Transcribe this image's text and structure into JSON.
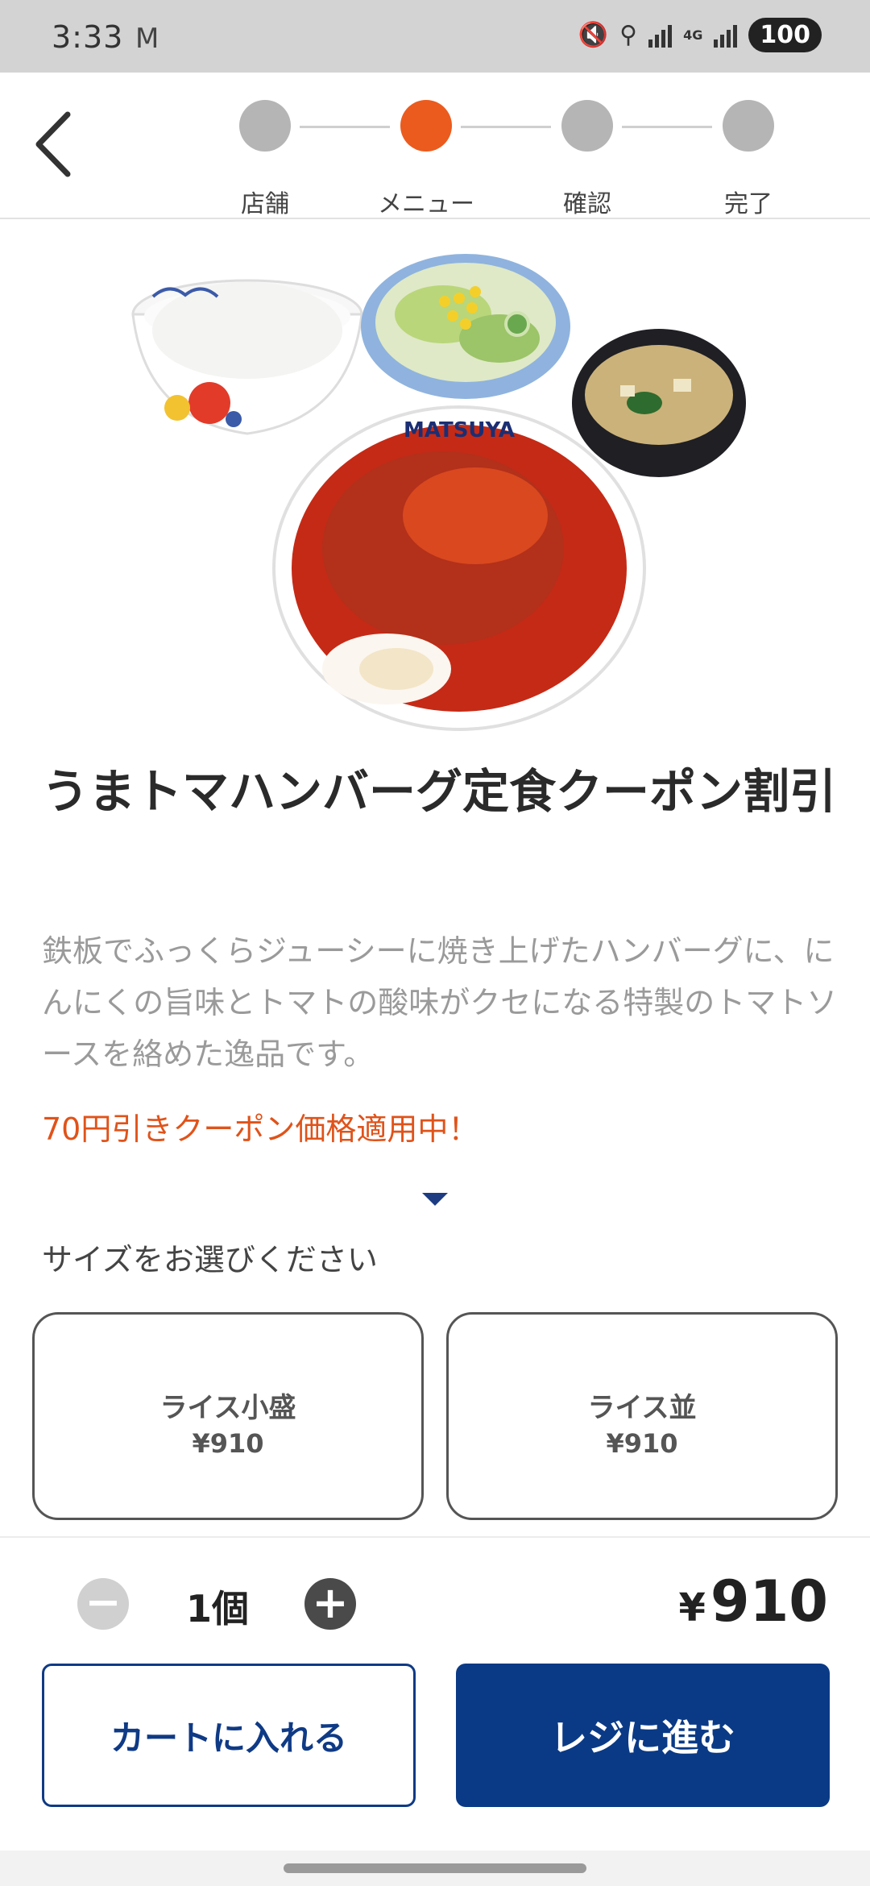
{
  "status_bar": {
    "time": "3:33",
    "mail_icon": "M",
    "network": "4G",
    "battery": "100"
  },
  "stepper": {
    "steps": [
      {
        "label": "店舗",
        "active": false
      },
      {
        "label": "メニュー",
        "active": true
      },
      {
        "label": "確認",
        "active": false
      },
      {
        "label": "完了",
        "active": false
      }
    ],
    "active_color": "#eb5b1e",
    "inactive_color": "#b5b5b5"
  },
  "product": {
    "image_icon": "set-meal-photo",
    "brand_on_plate": "MATSUYA",
    "title": "うまトマハンバーグ定食クーポン割引",
    "description": "鉄板でふっくらジューシーに焼き上げたハンバーグに、にんにくの旨味とトマトの酸味がクセになる特製のトマトソースを絡めた逸品です。",
    "coupon_note": "70円引きクーポン価格適用中！"
  },
  "size": {
    "prompt": "サイズをお選びください",
    "options": [
      {
        "name": "ライス小盛",
        "price": "¥910"
      },
      {
        "name": "ライス並",
        "price": "¥910"
      }
    ]
  },
  "order": {
    "minus": "−",
    "plus": "+",
    "quantity": "1個",
    "total_yen": "¥",
    "total_amount": "910",
    "add_to_cart": "カートに入れる",
    "checkout": "レジに進む"
  },
  "colors": {
    "brand_navy": "#0a3a86",
    "coupon_orange": "#e0531a"
  }
}
